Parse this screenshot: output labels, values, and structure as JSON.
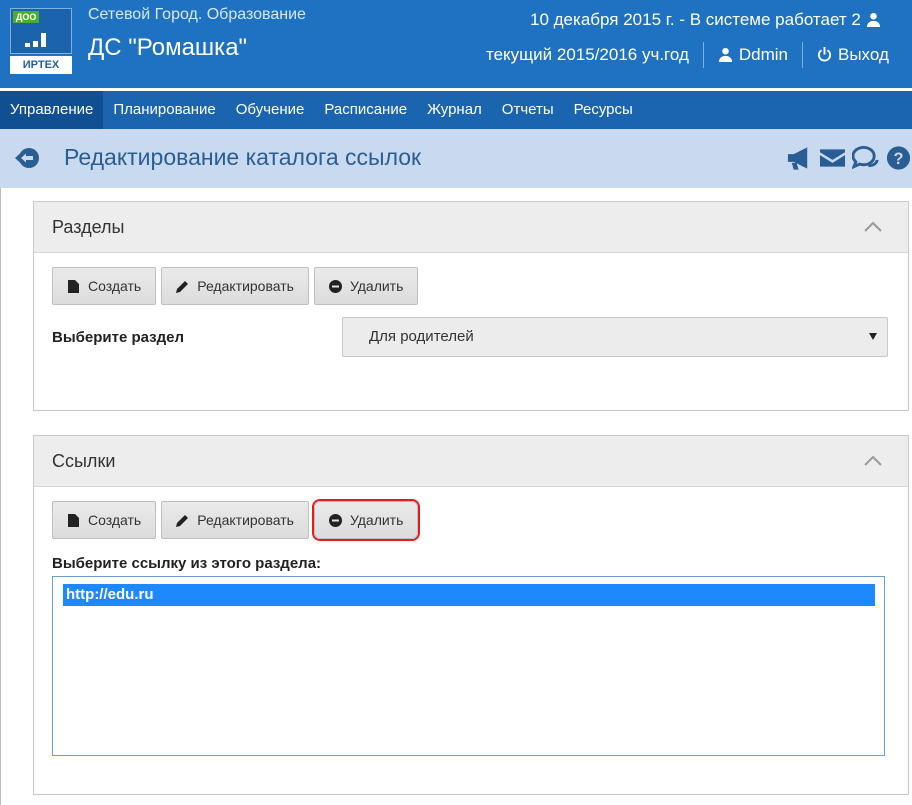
{
  "header": {
    "logo_tag": "ДОО",
    "logo_brand": "ИРТЕХ",
    "system_name": "Сетевой Город. Образование",
    "school_name": "ДС \"Ромашка\"",
    "date_line": "10 декабря 2015 г. - В системе работает 2",
    "year_line": "текущий 2015/2016 уч.год",
    "user_name": "Ddmin",
    "logout_label": "Выход"
  },
  "nav": {
    "items": [
      "Управление",
      "Планирование",
      "Обучение",
      "Расписание",
      "Журнал",
      "Отчеты",
      "Ресурсы"
    ],
    "active": "Управление"
  },
  "page": {
    "title": "Редактирование каталога ссылок"
  },
  "sections": {
    "title": "Разделы",
    "buttons": {
      "create": "Создать",
      "edit": "Редактировать",
      "delete": "Удалить"
    },
    "select_label": "Выберите раздел",
    "select_value": "Для родителей"
  },
  "links": {
    "title": "Ссылки",
    "buttons": {
      "create": "Создать",
      "edit": "Редактировать",
      "delete": "Удалить"
    },
    "list_label": "Выберите ссылку из этого раздела:",
    "items": [
      "http://edu.ru"
    ]
  },
  "colors": {
    "header_bg": "#1f72c1",
    "nav_bg": "#1a64b0",
    "titlebar_bg": "#c9daf0",
    "highlight": "#e11d1d",
    "selected_item": "#1e88ff"
  }
}
